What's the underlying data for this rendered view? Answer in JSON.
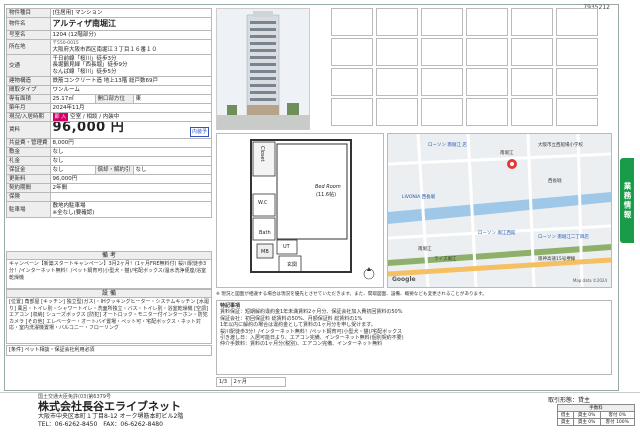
{
  "doc_id": "7935212",
  "spec": {
    "type": {
      "label": "物件種目",
      "value": "[住居用] マンション"
    },
    "name": {
      "label": "物件名",
      "value": "アルティザ南堀江"
    },
    "room": {
      "label": "号室名",
      "value": "1204 (12階部分)"
    },
    "location": {
      "label": "所在地",
      "zip": "〒550-0015",
      "value": "大阪府大阪市西区南堀江３丁目１６番１０"
    },
    "traffic": {
      "label": "交通",
      "lines": [
        "千日前線「桜川」徒歩3分",
        "長堀鶴見緑「西長堀」徒歩9分",
        "なんば線「桜川」徒歩5分"
      ]
    },
    "structure": {
      "label": "建物構造",
      "value": "鉄筋コンクリート造 地上13階 総戸数69戸"
    },
    "layout": {
      "label": "間取タイプ",
      "value": "ワンルーム"
    },
    "area": {
      "label": "専有面積",
      "value": "25.17㎡",
      "dir_label": "開口部方位",
      "dir_value": "東"
    },
    "built": {
      "label": "築年月",
      "value": "2024年11月"
    },
    "status": {
      "label": "現況/入居時期",
      "badge": "即 入",
      "value": "空室 / 相談 / 内装中"
    },
    "rent": {
      "label": "賃料",
      "value": "96,000 円",
      "link": "内装予"
    },
    "fee": {
      "label": "共益費・管理費",
      "value": "8,000円"
    },
    "deposit": {
      "label": "敷金",
      "value": "なし"
    },
    "key": {
      "label": "礼金",
      "value": "なし"
    },
    "guarantee": {
      "label": "保証金",
      "value": "なし",
      "sub_label": "償却・解約引",
      "sub_value": "なし"
    },
    "renewal": {
      "label": "更新料",
      "value": "96,000円"
    },
    "contract": {
      "label": "契約期間",
      "value": "2年間"
    },
    "insurance": {
      "label": "保険",
      "value": ""
    },
    "parking": {
      "label": "駐車場",
      "lines": [
        "敷地内駐車場",
        "※全なし(要確認)"
      ]
    }
  },
  "remarks": {
    "title": "備 考",
    "text": "キャンペーン【新築スタートキャンペーン】3月2ヶ月！(1ヶ月FRE無料付) 桜川駅徒歩3分！/インターネット無料！/ペット飼育可(小型犬・猫)/宅配ボックス/温水洗浄便座/浴室乾燥機"
  },
  "equipment": {
    "title": "設 備",
    "text": "[位置] 角部屋 [キッチン] 独立型(ガス)・IHクッキングヒーター・システムキッチン [水廻り] 風呂・トイレ別・シャワートイレ・洗面所独立・バス・トイレ別・浴室乾燥機 [空調] エアコン [収納] シューズボックス [防犯] オートロック・モニター付インターホン・防犯カメラ [その他] エレベーター・オートバイ置場・ペット可・宅配ボックス・ネット対応・室内洗濯機置場・バルコニー・フローリング"
  },
  "condition": {
    "text": "[条件] ペット相談・保証会社利用必須"
  },
  "floor_plan": {
    "closet": "Closet",
    "room": "Bed Room",
    "room_size": "(11.6帖)",
    "bath": "Bath",
    "wc": "W.C",
    "ut": "UT",
    "mb": "MB",
    "ent": "玄関"
  },
  "map": {
    "labels": [
      "ローソン 南堀江 店",
      "南堀江",
      "大阪市立西船場小学校",
      "西長堀",
      "LIVONIA 西長堀",
      "ローソン 堀江西館",
      "ローソン 南堀江二丁目店",
      "南堀江",
      "ライズ堀江",
      "阪神高速15号堺線"
    ],
    "google": "Google",
    "copyright": "Map data ©2024"
  },
  "notice": "※ 現況と図面が相違する場合は現況を優先とさせていただきます。また、間取図面、設備、概要なども変更されることがあります。",
  "special": {
    "title": "特記事項",
    "lines": [
      "賃料保証：短期解約違約金1年未満賃料2ヶ月分、保証会社加入費初回賃料の50%",
      "保証会社：初回保証料 総賃料の50%、月額保証料 総賃料の1%",
      "1年以内に解約の場合は違約金として賃料の1ヶ月分を申し受けます。",
      "桜川駅徒歩3分！/インターネット無料！/ペット飼育可(小型犬・猫)/宅配ボックス",
      "引き渡し日：入居可能日より、エアコン完備、インターネット無料(個別契約不要)",
      "仲介手数料：賃料の1ヶ月分(税別)、エアコン完備、インターネット無料"
    ]
  },
  "pager": {
    "current": "1/3",
    "tabs": [
      "2ヶ月"
    ]
  },
  "side_tab": "業務情報",
  "company": {
    "license": "国土交通大臣免許(03)第6379号",
    "name": "株式会社長谷エライブネット",
    "address": "大阪市中央区本町１丁目8-12 オーク堺筋本町ビル2階",
    "tel": "TEL：06-6262-8450　FAX：06-6262-8480"
  },
  "trade": {
    "label": "取引形態：貸主",
    "headers": [
      "手数料"
    ],
    "rows": [
      [
        "借主",
        "貸主 0%",
        "客付 0%"
      ],
      [
        "貸主",
        "貸主 0%",
        "客付 100%"
      ]
    ]
  }
}
